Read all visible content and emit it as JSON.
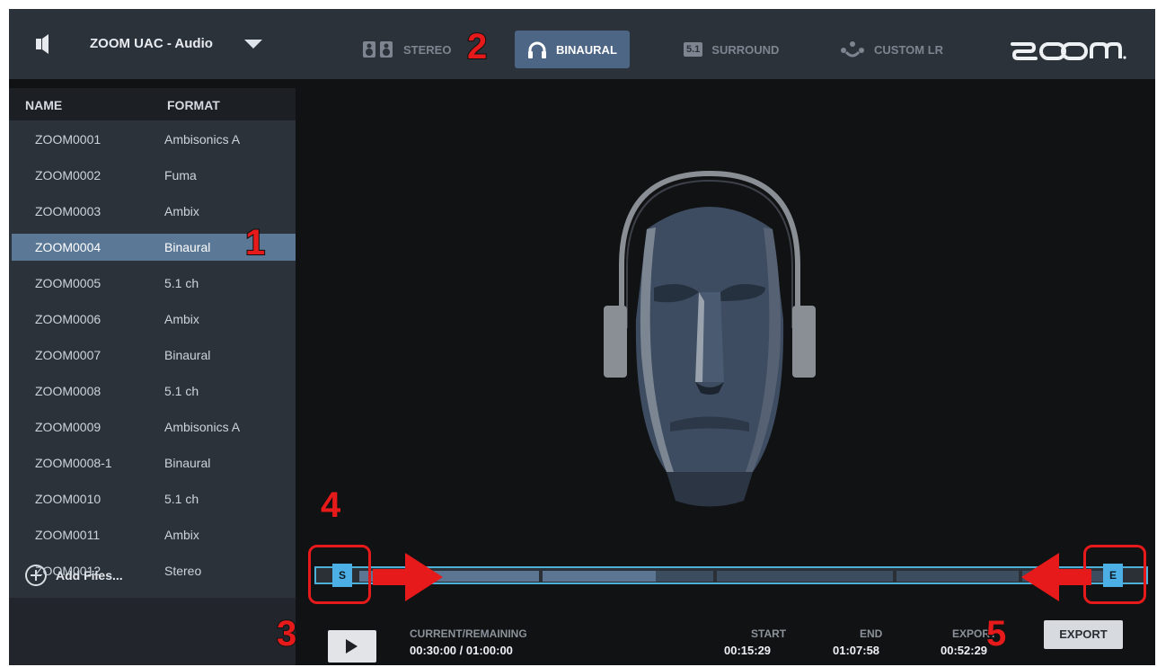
{
  "header": {
    "device_name": "ZOOM UAC - Audio",
    "modes": [
      {
        "label": "STEREO",
        "icon": "speakers-icon",
        "active": false
      },
      {
        "label": "BINAURAL",
        "icon": "headphones-icon",
        "active": true
      },
      {
        "label": "SURROUND",
        "icon": "surround-5-1-icon",
        "active": false
      },
      {
        "label": "CUSTOM LR",
        "icon": "custom-lr-icon",
        "active": false
      }
    ],
    "surround_badge": "5.1",
    "logo": "ZOOM"
  },
  "files": {
    "columns": [
      "NAME",
      "FORMAT"
    ],
    "rows": [
      {
        "name": "ZOOM0001",
        "format": "Ambisonics A"
      },
      {
        "name": "ZOOM0002",
        "format": "Fuma"
      },
      {
        "name": "ZOOM0003",
        "format": "Ambix"
      },
      {
        "name": "ZOOM0004",
        "format": "Binaural",
        "selected": true
      },
      {
        "name": "ZOOM0005",
        "format": "5.1 ch"
      },
      {
        "name": "ZOOM0006",
        "format": "Ambix"
      },
      {
        "name": "ZOOM0007",
        "format": "Binaural"
      },
      {
        "name": "ZOOM0008",
        "format": "5.1 ch"
      },
      {
        "name": "ZOOM0009",
        "format": "Ambisonics A"
      },
      {
        "name": "ZOOM0008-1",
        "format": "Binaural"
      },
      {
        "name": "ZOOM0010",
        "format": "5.1 ch"
      },
      {
        "name": "ZOOM0011",
        "format": "Ambix"
      },
      {
        "name": "ZOOM0012",
        "format": "Stereo"
      }
    ],
    "add_files_label": "Add Files..."
  },
  "timeline": {
    "start_marker": "S",
    "end_marker": "E",
    "progress_fraction": 0.5
  },
  "transport": {
    "current_remaining_label": "CURRENT/REMAINING",
    "current_remaining_value": "00:30:00 / 01:00:00",
    "start_label": "START",
    "start_value": "00:15:29",
    "end_label": "END",
    "end_value": "01:07:58",
    "export_time_label": "EXPORT",
    "export_time_value": "00:52:29",
    "export_button": "EXPORT"
  },
  "annotations": [
    "1",
    "2",
    "3",
    "4",
    "5"
  ],
  "colors": {
    "accent": "#4cb0e6",
    "selected_row": "#5b7896",
    "annotation_red": "#e61a1a"
  }
}
